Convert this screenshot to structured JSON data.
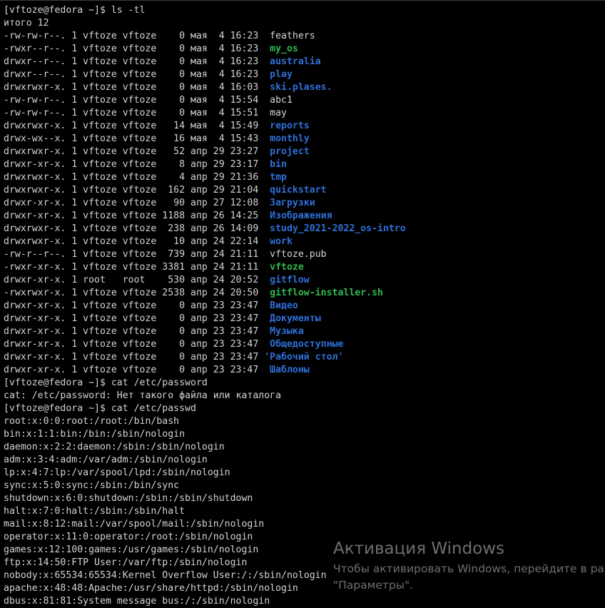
{
  "colors": {
    "background": "#000000",
    "text": "#d4d4d4",
    "directory": "#2f6fd8",
    "executable": "#2eb84e"
  },
  "terminal": {
    "lines": [
      {
        "segments": [
          {
            "t": "[vftoze@fedora ~]$ ls -tl"
          }
        ]
      },
      {
        "segments": [
          {
            "t": "итого 12"
          }
        ]
      },
      {
        "segments": [
          {
            "t": "-rw-rw-r--. 1 vftoze vftoze    0 мая  4 16:23  "
          },
          {
            "t": "feathers"
          }
        ]
      },
      {
        "segments": [
          {
            "t": "-rwxr--r--. 1 vftoze vftoze    0 мая  4 16:23  "
          },
          {
            "t": "my_os",
            "c": "exec"
          }
        ]
      },
      {
        "segments": [
          {
            "t": "drwxr--r--. 1 vftoze vftoze    0 мая  4 16:23  "
          },
          {
            "t": "australia",
            "c": "dir"
          }
        ]
      },
      {
        "segments": [
          {
            "t": "drwxr--r--. 1 vftoze vftoze    0 мая  4 16:23  "
          },
          {
            "t": "play",
            "c": "dir"
          }
        ]
      },
      {
        "segments": [
          {
            "t": "drwxrwxr-x. 1 vftoze vftoze    0 мая  4 16:03  "
          },
          {
            "t": "ski.plases.",
            "c": "dir"
          }
        ]
      },
      {
        "segments": [
          {
            "t": "-rw-rw-r--. 1 vftoze vftoze    0 мая  4 15:54  "
          },
          {
            "t": "abc1"
          }
        ]
      },
      {
        "segments": [
          {
            "t": "-rw-rw-r--. 1 vftoze vftoze    0 мая  4 15:51  "
          },
          {
            "t": "may"
          }
        ]
      },
      {
        "segments": [
          {
            "t": "drwxrwxr-x. 1 vftoze vftoze   14 мая  4 15:49  "
          },
          {
            "t": "reports",
            "c": "dir"
          }
        ]
      },
      {
        "segments": [
          {
            "t": "drwx-wx--x. 1 vftoze vftoze   16 мая  4 15:43  "
          },
          {
            "t": "monthly",
            "c": "dir"
          }
        ]
      },
      {
        "segments": [
          {
            "t": "drwxrwxr-x. 1 vftoze vftoze   52 апр 29 23:27  "
          },
          {
            "t": "project",
            "c": "dir"
          }
        ]
      },
      {
        "segments": [
          {
            "t": "drwxr-xr-x. 1 vftoze vftoze    8 апр 29 23:17  "
          },
          {
            "t": "bin",
            "c": "dir"
          }
        ]
      },
      {
        "segments": [
          {
            "t": "drwxrwxr-x. 1 vftoze vftoze    4 апр 29 21:36  "
          },
          {
            "t": "tmp",
            "c": "dir"
          }
        ]
      },
      {
        "segments": [
          {
            "t": "drwxrwxr-x. 1 vftoze vftoze  162 апр 29 21:04  "
          },
          {
            "t": "quickstart",
            "c": "dir"
          }
        ]
      },
      {
        "segments": [
          {
            "t": "drwxr-xr-x. 1 vftoze vftoze   90 апр 27 12:08  "
          },
          {
            "t": "Загрузки",
            "c": "dir"
          }
        ]
      },
      {
        "segments": [
          {
            "t": "drwxr-xr-x. 1 vftoze vftoze 1188 апр 26 14:25  "
          },
          {
            "t": "Изображения",
            "c": "dir"
          }
        ]
      },
      {
        "segments": [
          {
            "t": "drwxrwxr-x. 1 vftoze vftoze  238 апр 26 14:09  "
          },
          {
            "t": "study_2021-2022_os-intro",
            "c": "dir"
          }
        ]
      },
      {
        "segments": [
          {
            "t": "drwxrwxr-x. 1 vftoze vftoze   10 апр 24 22:14  "
          },
          {
            "t": "work",
            "c": "dir"
          }
        ]
      },
      {
        "segments": [
          {
            "t": "-rw-r--r--. 1 vftoze vftoze  739 апр 24 21:11  "
          },
          {
            "t": "vftoze.pub"
          }
        ]
      },
      {
        "segments": [
          {
            "t": "-rwxr-xr-x. 1 vftoze vftoze 3381 апр 24 21:11  "
          },
          {
            "t": "vftoze",
            "c": "exec"
          }
        ]
      },
      {
        "segments": [
          {
            "t": "drwxr-xr-x. 1 root   root    530 апр 24 20:52  "
          },
          {
            "t": "gitflow",
            "c": "dir"
          }
        ]
      },
      {
        "segments": [
          {
            "t": "-rwxrwxr-x. 1 vftoze vftoze 2538 апр 24 20:50  "
          },
          {
            "t": "gitflow-installer.sh",
            "c": "exec"
          }
        ]
      },
      {
        "segments": [
          {
            "t": "drwxr-xr-x. 1 vftoze vftoze    0 апр 23 23:47  "
          },
          {
            "t": "Видео",
            "c": "dir"
          }
        ]
      },
      {
        "segments": [
          {
            "t": "drwxr-xr-x. 1 vftoze vftoze    0 апр 23 23:47  "
          },
          {
            "t": "Документы",
            "c": "dir"
          }
        ]
      },
      {
        "segments": [
          {
            "t": "drwxr-xr-x. 1 vftoze vftoze    0 апр 23 23:47  "
          },
          {
            "t": "Музыка",
            "c": "dir"
          }
        ]
      },
      {
        "segments": [
          {
            "t": "drwxr-xr-x. 1 vftoze vftoze    0 апр 23 23:47  "
          },
          {
            "t": "Общедоступные",
            "c": "dir"
          }
        ]
      },
      {
        "segments": [
          {
            "t": "drwxr-xr-x. 1 vftoze vftoze    0 апр 23 23:47 "
          },
          {
            "t": "'Рабочий стол'",
            "c": "dir"
          }
        ]
      },
      {
        "segments": [
          {
            "t": "drwxr-xr-x. 1 vftoze vftoze    0 апр 23 23:47  "
          },
          {
            "t": "Шаблоны",
            "c": "dir"
          }
        ]
      },
      {
        "segments": [
          {
            "t": "[vftoze@fedora ~]$ cat /etc/password"
          }
        ]
      },
      {
        "segments": [
          {
            "t": "cat: /etc/password: Нет такого файла или каталога"
          }
        ]
      },
      {
        "segments": [
          {
            "t": "[vftoze@fedora ~]$ cat /etc/passwd"
          }
        ]
      },
      {
        "segments": [
          {
            "t": "root:x:0:0:root:/root:/bin/bash"
          }
        ]
      },
      {
        "segments": [
          {
            "t": "bin:x:1:1:bin:/bin:/sbin/nologin"
          }
        ]
      },
      {
        "segments": [
          {
            "t": "daemon:x:2:2:daemon:/sbin:/sbin/nologin"
          }
        ]
      },
      {
        "segments": [
          {
            "t": "adm:x:3:4:adm:/var/adm:/sbin/nologin"
          }
        ]
      },
      {
        "segments": [
          {
            "t": "lp:x:4:7:lp:/var/spool/lpd:/sbin/nologin"
          }
        ]
      },
      {
        "segments": [
          {
            "t": "sync:x:5:0:sync:/sbin:/bin/sync"
          }
        ]
      },
      {
        "segments": [
          {
            "t": "shutdown:x:6:0:shutdown:/sbin:/sbin/shutdown"
          }
        ]
      },
      {
        "segments": [
          {
            "t": "halt:x:7:0:halt:/sbin:/sbin/halt"
          }
        ]
      },
      {
        "segments": [
          {
            "t": "mail:x:8:12:mail:/var/spool/mail:/sbin/nologin"
          }
        ]
      },
      {
        "segments": [
          {
            "t": "operator:x:11:0:operator:/root:/sbin/nologin"
          }
        ]
      },
      {
        "segments": [
          {
            "t": "games:x:12:100:games:/usr/games:/sbin/nologin"
          }
        ]
      },
      {
        "segments": [
          {
            "t": "ftp:x:14:50:FTP User:/var/ftp:/sbin/nologin"
          }
        ]
      },
      {
        "segments": [
          {
            "t": "nobody:x:65534:65534:Kernel Overflow User:/:/sbin/nologin"
          }
        ]
      },
      {
        "segments": [
          {
            "t": "apache:x:48:48:Apache:/usr/share/httpd:/sbin/nologin"
          }
        ]
      },
      {
        "segments": [
          {
            "t": "dbus:x:81:81:System message bus:/:/sbin/nologin"
          }
        ]
      }
    ]
  },
  "watermark": {
    "title": "Активация Windows",
    "line1": "Чтобы активировать Windows, перейдите в раздел",
    "line2": "\"Параметры\"."
  }
}
